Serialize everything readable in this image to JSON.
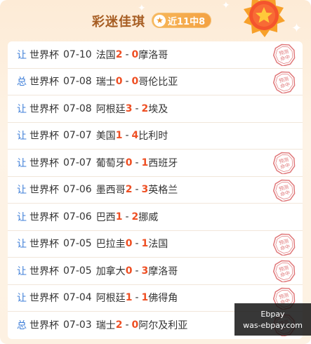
{
  "header": {
    "title": "彩迷佳琪",
    "streak": "近11中8"
  },
  "colors": {
    "handicap_type": "#3c7dd8",
    "score": "#ee4f23",
    "title": "#a65c21",
    "stamp": "#e0787a"
  },
  "stamp_text": [
    "预测",
    "命中"
  ],
  "matches": [
    {
      "type": "让",
      "competition": "世界杯",
      "date": "07-10",
      "home": "法国",
      "home_score": "2",
      "away_score": "0",
      "away": "摩洛哥",
      "hit": true
    },
    {
      "type": "总",
      "competition": "世界杯",
      "date": "07-08",
      "home": "瑞士",
      "home_score": "0",
      "away_score": "0",
      "away": "哥伦比亚",
      "hit": true
    },
    {
      "type": "让",
      "competition": "世界杯",
      "date": "07-08",
      "home": "阿根廷",
      "home_score": "3",
      "away_score": "2",
      "away": "埃及",
      "hit": false
    },
    {
      "type": "让",
      "competition": "世界杯",
      "date": "07-07",
      "home": "美国",
      "home_score": "1",
      "away_score": "4",
      "away": "比利时",
      "hit": false
    },
    {
      "type": "让",
      "competition": "世界杯",
      "date": "07-07",
      "home": "葡萄牙",
      "home_score": "0",
      "away_score": "1",
      "away": "西班牙",
      "hit": true
    },
    {
      "type": "让",
      "competition": "世界杯",
      "date": "07-06",
      "home": "墨西哥",
      "home_score": "2",
      "away_score": "3",
      "away": "英格兰",
      "hit": true
    },
    {
      "type": "让",
      "competition": "世界杯",
      "date": "07-06",
      "home": "巴西",
      "home_score": "1",
      "away_score": "2",
      "away": "挪威",
      "hit": false
    },
    {
      "type": "让",
      "competition": "世界杯",
      "date": "07-05",
      "home": "巴拉圭",
      "home_score": "0",
      "away_score": "1",
      "away": "法国",
      "hit": true
    },
    {
      "type": "让",
      "competition": "世界杯",
      "date": "07-05",
      "home": "加拿大",
      "home_score": "0",
      "away_score": "3",
      "away": "摩洛哥",
      "hit": true
    },
    {
      "type": "让",
      "competition": "世界杯",
      "date": "07-04",
      "home": "阿根廷",
      "home_score": "1",
      "away_score": "1",
      "away": "佛得角",
      "hit": true
    },
    {
      "type": "总",
      "competition": "世界杯",
      "date": "07-03",
      "home": "瑞士",
      "home_score": "2",
      "away_score": "0",
      "away": "阿尔及利亚",
      "hit": true
    }
  ],
  "watermark": {
    "line1": "Ebpay",
    "line2": "was-ebpay.com"
  }
}
